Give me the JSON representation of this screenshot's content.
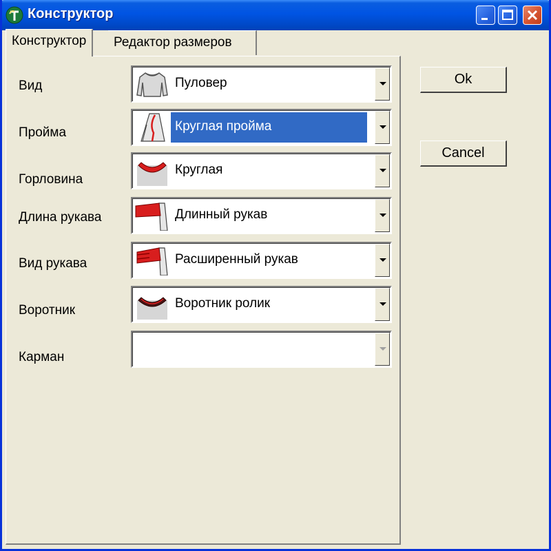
{
  "window": {
    "title": "Конструктор"
  },
  "tabs": [
    {
      "label": "Конструктор",
      "active": true
    },
    {
      "label": "Редактор размеров",
      "active": false
    }
  ],
  "fields": [
    {
      "label": "Вид",
      "value": "Пуловер",
      "icon": "pullover-icon"
    },
    {
      "label": "Пройма",
      "value": "Круглая пройма",
      "icon": "armhole-icon",
      "selected": true
    },
    {
      "label": "Горловина",
      "value": "Круглая",
      "icon": "neckline-icon"
    },
    {
      "label": "Длина рукава",
      "value": "Длинный рукав",
      "icon": "long-sleeve-icon"
    },
    {
      "label": "Вид рукава",
      "value": "Расширенный рукав",
      "icon": "flared-sleeve-icon"
    },
    {
      "label": "Воротник",
      "value": "Воротник ролик",
      "icon": "roll-collar-icon"
    },
    {
      "label": "Карман",
      "value": "",
      "icon": "",
      "disabled": true
    }
  ],
  "buttons": {
    "ok": "Ok",
    "cancel": "Cancel"
  },
  "colors": {
    "titlebar": "#0054e3",
    "window_bg": "#ece9d8",
    "selection": "#316ac5",
    "accent_red": "#d81e1e"
  }
}
